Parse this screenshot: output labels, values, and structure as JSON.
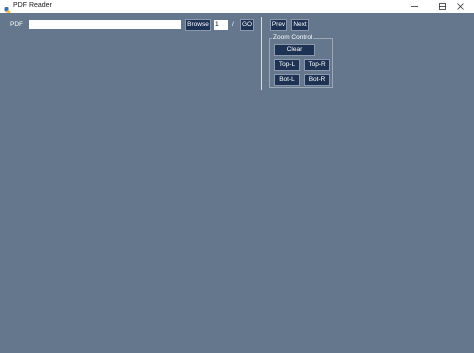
{
  "window": {
    "title": "PDF Reader",
    "controls": {
      "minimize": "minimize-icon",
      "maximize": "maximize-icon",
      "close": "close-icon"
    }
  },
  "toolbar": {
    "pdf_label": "PDF",
    "pdf_path_value": "",
    "browse_label": "Browse",
    "page_value": "1",
    "page_separator": "/",
    "go_label": "GO"
  },
  "nav": {
    "prev_label": "Prev",
    "next_label": "Next"
  },
  "zoom": {
    "title": "Zoom Control",
    "clear_label": "Clear",
    "top_left_label": "Top-L",
    "top_right_label": "Top-R",
    "bottom_left_label": "Bot-L",
    "bottom_right_label": "Bot-R"
  },
  "colors": {
    "background": "#64778d",
    "button": "#1e3354",
    "text": "#ffffff"
  }
}
